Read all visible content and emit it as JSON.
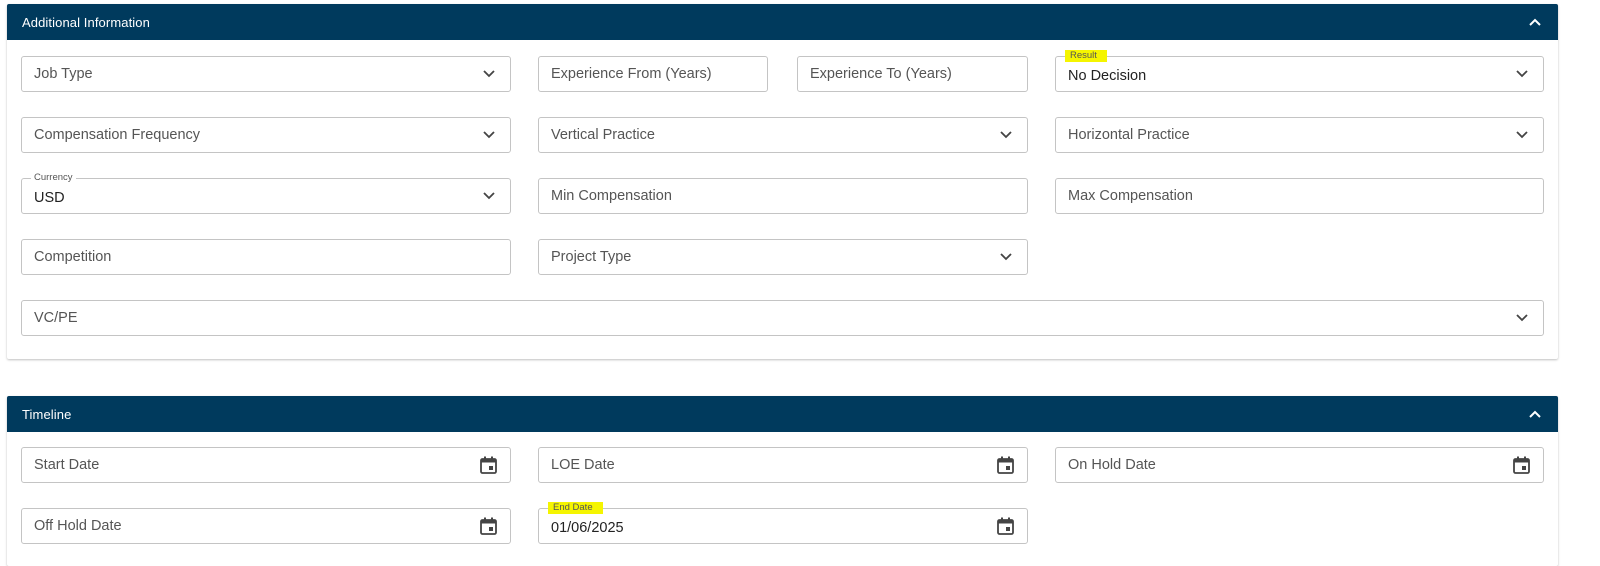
{
  "additional_info": {
    "title": "Additional Information",
    "job_type": "Job Type",
    "experience_from": "Experience From (Years)",
    "experience_to": "Experience To (Years)",
    "result": {
      "label": "Result",
      "value": "No Decision"
    },
    "compensation_frequency": "Compensation Frequency",
    "vertical_practice": "Vertical Practice",
    "horizontal_practice": "Horizontal Practice",
    "currency": {
      "label": "Currency",
      "value": "USD"
    },
    "min_compensation": "Min Compensation",
    "max_compensation": "Max Compensation",
    "competition": "Competition",
    "project_type": "Project Type",
    "vc_pe": "VC/PE"
  },
  "timeline": {
    "title": "Timeline",
    "start_date": "Start Date",
    "loe_date": "LOE Date",
    "on_hold_date": "On Hold Date",
    "off_hold_date": "Off Hold Date",
    "end_date": {
      "label": "End Date",
      "value": "01/06/2025"
    }
  },
  "colors": {
    "header_bg": "#003a5d",
    "highlight": "#f5f500",
    "border": "#c4c4c4"
  },
  "icons": [
    "chevron-up-icon",
    "chevron-down-icon",
    "calendar-icon"
  ]
}
